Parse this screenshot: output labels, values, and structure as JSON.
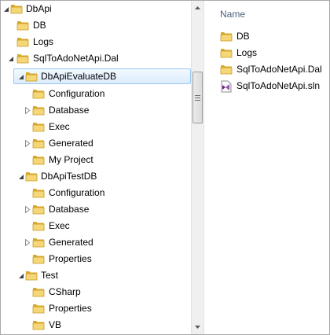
{
  "tree": {
    "items": [
      {
        "label": "DbApi",
        "expanded": true,
        "has_children": true
      },
      {
        "label": "DB",
        "has_children": false
      },
      {
        "label": "Logs",
        "has_children": false
      },
      {
        "label": "SqlToAdoNetApi.Dal",
        "expanded": true,
        "has_children": true
      },
      {
        "label": "DbApiEvaluateDB",
        "expanded": true,
        "has_children": true,
        "selected": true
      },
      {
        "label": "Configuration",
        "has_children": false
      },
      {
        "label": "Database",
        "expanded": false,
        "has_children": true
      },
      {
        "label": "Exec",
        "has_children": false
      },
      {
        "label": "Generated",
        "expanded": false,
        "has_children": true
      },
      {
        "label": "My Project",
        "has_children": false
      },
      {
        "label": "DbApiTestDB",
        "expanded": true,
        "has_children": true
      },
      {
        "label": "Configuration",
        "has_children": false
      },
      {
        "label": "Database",
        "expanded": false,
        "has_children": true
      },
      {
        "label": "Exec",
        "has_children": false
      },
      {
        "label": "Generated",
        "expanded": false,
        "has_children": true
      },
      {
        "label": "Properties",
        "has_children": false
      },
      {
        "label": "Test",
        "expanded": true,
        "has_children": true
      },
      {
        "label": "CSharp",
        "has_children": false
      },
      {
        "label": "Properties",
        "has_children": false
      },
      {
        "label": "VB",
        "has_children": false
      }
    ]
  },
  "list": {
    "column_name": "Name",
    "items": [
      {
        "label": "DB",
        "icon": "folder-icon"
      },
      {
        "label": "Logs",
        "icon": "folder-icon"
      },
      {
        "label": "SqlToAdoNetApi.Dal",
        "icon": "folder-icon"
      },
      {
        "label": "SqlToAdoNetApi.sln",
        "icon": "solution-file-icon"
      }
    ]
  },
  "colors": {
    "folder": "#e8c253",
    "selection_border": "#99c8f5",
    "header_text": "#4c607a"
  }
}
